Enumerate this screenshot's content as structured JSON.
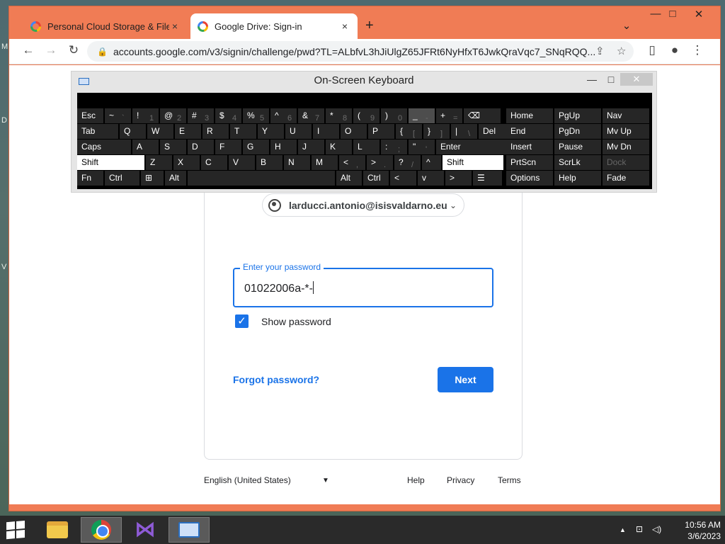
{
  "desktop": {
    "left_letters": [
      "M",
      "D",
      "V"
    ]
  },
  "browser": {
    "tabs": [
      {
        "title": "Personal Cloud Storage & File Sh",
        "close": "×",
        "active": false
      },
      {
        "title": "Google Drive: Sign-in",
        "close": "×",
        "active": true
      }
    ],
    "new_tab": "+",
    "window_controls": {
      "dropdown": "⌄",
      "minimize": "—",
      "maximize": "□",
      "close": "✕"
    },
    "nav": {
      "back": "←",
      "forward": "→",
      "reload": "↻"
    },
    "url": "accounts.google.com/v3/signin/challenge/pwd?TL=ALbfvL3hJiUlgZ65JFRt6NyHfxT6JwkQraVqc7_SNqRQQ...",
    "omnibox_icons": {
      "share": "⇪",
      "star": "☆",
      "sidepanel": "▯",
      "profile": "●",
      "menu": "⋮"
    }
  },
  "osk": {
    "title": "On-Screen Keyboard",
    "controls": {
      "minimize": "—",
      "maximize": "□",
      "close": "✕"
    },
    "keys": [
      {
        "label": "Esc",
        "sub": ""
      },
      {
        "label": "~",
        "sub": "`"
      },
      {
        "label": "!",
        "sub": "1"
      },
      {
        "label": "@",
        "sub": "2"
      },
      {
        "label": "#",
        "sub": "3"
      },
      {
        "label": "$",
        "sub": "4"
      },
      {
        "label": "%",
        "sub": "5"
      },
      {
        "label": "^",
        "sub": "6"
      },
      {
        "label": "&",
        "sub": "7"
      },
      {
        "label": "*",
        "sub": "8"
      },
      {
        "label": "(",
        "sub": "9"
      },
      {
        "label": ")",
        "sub": "0"
      },
      {
        "label": "_",
        "sub": "-"
      },
      {
        "label": "+",
        "sub": "="
      },
      {
        "label": "⌫",
        "sub": ""
      },
      {
        "label": "Tab",
        "sub": ""
      },
      {
        "label": "Q",
        "sub": ""
      },
      {
        "label": "W",
        "sub": ""
      },
      {
        "label": "E",
        "sub": ""
      },
      {
        "label": "R",
        "sub": ""
      },
      {
        "label": "T",
        "sub": ""
      },
      {
        "label": "Y",
        "sub": ""
      },
      {
        "label": "U",
        "sub": ""
      },
      {
        "label": "I",
        "sub": ""
      },
      {
        "label": "O",
        "sub": ""
      },
      {
        "label": "P",
        "sub": ""
      },
      {
        "label": "{",
        "sub": "["
      },
      {
        "label": "}",
        "sub": "]"
      },
      {
        "label": "|",
        "sub": "\\"
      },
      {
        "label": "Del",
        "sub": ""
      },
      {
        "label": "Caps",
        "sub": ""
      },
      {
        "label": "A",
        "sub": ""
      },
      {
        "label": "S",
        "sub": ""
      },
      {
        "label": "D",
        "sub": ""
      },
      {
        "label": "F",
        "sub": ""
      },
      {
        "label": "G",
        "sub": ""
      },
      {
        "label": "H",
        "sub": ""
      },
      {
        "label": "J",
        "sub": ""
      },
      {
        "label": "K",
        "sub": ""
      },
      {
        "label": "L",
        "sub": ""
      },
      {
        "label": ":",
        "sub": ";"
      },
      {
        "label": "\"",
        "sub": "'"
      },
      {
        "label": "Enter",
        "sub": ""
      },
      {
        "label": "Shift",
        "sub": ""
      },
      {
        "label": "Z",
        "sub": ""
      },
      {
        "label": "X",
        "sub": ""
      },
      {
        "label": "C",
        "sub": ""
      },
      {
        "label": "V",
        "sub": ""
      },
      {
        "label": "B",
        "sub": ""
      },
      {
        "label": "N",
        "sub": ""
      },
      {
        "label": "M",
        "sub": ""
      },
      {
        "label": "<",
        "sub": ","
      },
      {
        "label": ">",
        "sub": "."
      },
      {
        "label": "?",
        "sub": "/"
      },
      {
        "label": "^",
        "sub": ""
      },
      {
        "label": "Shift",
        "sub": ""
      },
      {
        "label": "Fn",
        "sub": ""
      },
      {
        "label": "Ctrl",
        "sub": ""
      },
      {
        "label": "⊞",
        "sub": ""
      },
      {
        "label": "Alt",
        "sub": ""
      },
      {
        "label": "",
        "sub": ""
      },
      {
        "label": "Alt",
        "sub": ""
      },
      {
        "label": "Ctrl",
        "sub": ""
      },
      {
        "label": "<",
        "sub": ""
      },
      {
        "label": "v",
        "sub": ""
      },
      {
        "label": ">",
        "sub": ""
      },
      {
        "label": "☰",
        "sub": ""
      },
      {
        "label": "Home",
        "sub": ""
      },
      {
        "label": "PgUp",
        "sub": ""
      },
      {
        "label": "Nav",
        "sub": ""
      },
      {
        "label": "End",
        "sub": ""
      },
      {
        "label": "PgDn",
        "sub": ""
      },
      {
        "label": "Mv Up",
        "sub": ""
      },
      {
        "label": "Insert",
        "sub": ""
      },
      {
        "label": "Pause",
        "sub": ""
      },
      {
        "label": "Mv Dn",
        "sub": ""
      },
      {
        "label": "PrtScn",
        "sub": ""
      },
      {
        "label": "ScrLk",
        "sub": ""
      },
      {
        "label": "Dock",
        "sub": ""
      },
      {
        "label": "Options",
        "sub": ""
      },
      {
        "label": "Help",
        "sub": ""
      },
      {
        "label": "Fade",
        "sub": ""
      }
    ]
  },
  "signin": {
    "account_email": "larducci.antonio@isisvaldarno.eu",
    "chevron": "⌄",
    "password_label": "Enter your password",
    "password_value": "01022006a-*-",
    "show_password_checked": true,
    "check_glyph": "✓",
    "show_password_label": "Show password",
    "forgot_password": "Forgot password?",
    "next": "Next"
  },
  "footer": {
    "language": "English (United States)",
    "language_arrow": "▼",
    "help": "Help",
    "privacy": "Privacy",
    "terms": "Terms"
  },
  "taskbar": {
    "tray": {
      "overflow": "▲",
      "network": "⊡",
      "volume": "◁)"
    },
    "time": "10:56 AM",
    "date": "3/6/2023"
  },
  "colors": {
    "accent": "#1a73e8",
    "browser_frame": "#f07c55",
    "taskbar": "#2a2a2a"
  }
}
